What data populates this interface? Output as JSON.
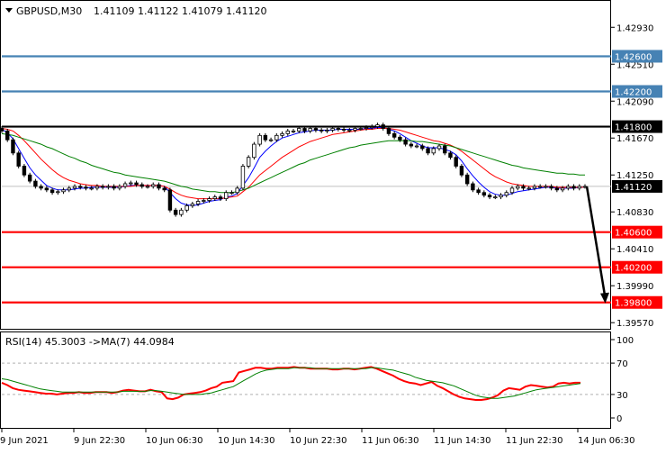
{
  "header": {
    "symbol_info": "GBPUSD,M30",
    "ohlc": "1.41109 1.41122 1.41079 1.41120"
  },
  "chart_data": [
    {
      "type": "candlestick",
      "symbol": "GBPUSD",
      "timeframe": "M30",
      "title": "GBPUSD,M30",
      "last_ohlc": {
        "open": 1.41109,
        "high": 1.41122,
        "low": 1.41079,
        "close": 1.4112
      },
      "y_ticks": [
        "1.42930",
        "1.42510",
        "1.42090",
        "1.41670",
        "1.41250",
        "1.40830",
        "1.40410",
        "1.39990",
        "1.39570"
      ],
      "ylim": [
        1.3949,
        1.4323
      ],
      "x_ticks": [
        "9 Jun 2021",
        "9 Jun 22:30",
        "10 Jun 06:30",
        "10 Jun 14:30",
        "10 Jun 22:30",
        "11 Jun 06:30",
        "11 Jun 14:30",
        "11 Jun 22:30",
        "14 Jun 06:30"
      ],
      "current_price": {
        "value": 1.4112,
        "label": "1.41120"
      },
      "levels": [
        {
          "value": 1.426,
          "label": "1.42600",
          "color": "#4682b4"
        },
        {
          "value": 1.422,
          "label": "1.42200",
          "color": "#4682b4"
        },
        {
          "value": 1.418,
          "label": "1.41800",
          "color": "#000000"
        },
        {
          "value": 1.406,
          "label": "1.40600",
          "color": "#ff0000"
        },
        {
          "value": 1.402,
          "label": "1.40200",
          "color": "#ff0000"
        },
        {
          "value": 1.398,
          "label": "1.39800",
          "color": "#ff0000"
        }
      ],
      "projection": {
        "from": 1.4112,
        "to": 1.398,
        "color": "#000000"
      },
      "close_series": [
        1.4175,
        1.4165,
        1.415,
        1.4135,
        1.4125,
        1.4118,
        1.4112,
        1.411,
        1.4108,
        1.4105,
        1.4106,
        1.4108,
        1.411,
        1.4112,
        1.4111,
        1.411,
        1.411,
        1.4112,
        1.4111,
        1.4112,
        1.411,
        1.4112,
        1.4115,
        1.4116,
        1.4114,
        1.4112,
        1.4112,
        1.4114,
        1.411,
        1.4108,
        1.4085,
        1.408,
        1.4085,
        1.409,
        1.4092,
        1.4095,
        1.4096,
        1.4098,
        1.41,
        1.4098,
        1.4105,
        1.4105,
        1.411,
        1.4135,
        1.4145,
        1.416,
        1.417,
        1.4165,
        1.4165,
        1.417,
        1.4172,
        1.4175,
        1.4175,
        1.4178,
        1.4175,
        1.4178,
        1.4176,
        1.4175,
        1.4176,
        1.4178,
        1.4177,
        1.4176,
        1.4176,
        1.4178,
        1.4178,
        1.4179,
        1.418,
        1.4182,
        1.4178,
        1.4172,
        1.4168,
        1.4165,
        1.416,
        1.4158,
        1.4158,
        1.4155,
        1.415,
        1.4155,
        1.4158,
        1.415,
        1.4145,
        1.4135,
        1.4125,
        1.4115,
        1.4108,
        1.4105,
        1.4102,
        1.41,
        1.41,
        1.4102,
        1.4105,
        1.411,
        1.4112,
        1.411,
        1.411,
        1.4112,
        1.4112,
        1.4112,
        1.411,
        1.4108,
        1.411,
        1.4112,
        1.411,
        1.4112,
        1.4112
      ],
      "moving_averages": [
        {
          "color": "#0000ff",
          "series": [
            1.4177,
            1.4173,
            1.4166,
            1.4155,
            1.4144,
            1.4133,
            1.4125,
            1.4119,
            1.4113,
            1.411,
            1.4108,
            1.4108,
            1.4108,
            1.4109,
            1.411,
            1.411,
            1.4111,
            1.4111,
            1.4111,
            1.4111,
            1.4111,
            1.4111,
            1.4112,
            1.4113,
            1.4113,
            1.4113,
            1.4113,
            1.4113,
            1.4113,
            1.4112,
            1.4105,
            1.4098,
            1.4093,
            1.4091,
            1.409,
            1.4091,
            1.4093,
            1.4095,
            1.4096,
            1.4097,
            1.41,
            1.4101,
            1.4104,
            1.4113,
            1.4122,
            1.4133,
            1.4145,
            1.4152,
            1.4158,
            1.4163,
            1.4167,
            1.4169,
            1.4171,
            1.4173,
            1.4174,
            1.4175,
            1.4176,
            1.4176,
            1.4176,
            1.4176,
            1.4177,
            1.4177,
            1.4177,
            1.4177,
            1.4177,
            1.4178,
            1.4178,
            1.4179,
            1.4179,
            1.4177,
            1.4175,
            1.4172,
            1.4168,
            1.4164,
            1.4161,
            1.4158,
            1.4156,
            1.4156,
            1.4156,
            1.4154,
            1.4152,
            1.4148,
            1.4141,
            1.4132,
            1.4124,
            1.4117,
            1.4111,
            1.4106,
            1.4103,
            1.4102,
            1.4102,
            1.4104,
            1.4106,
            1.4107,
            1.4108,
            1.4109,
            1.411,
            1.4111,
            1.4111,
            1.411,
            1.411,
            1.411,
            1.411,
            1.4111,
            1.4111
          ]
        },
        {
          "color": "#ff0000",
          "series": [
            1.4178,
            1.4177,
            1.4175,
            1.417,
            1.4164,
            1.4157,
            1.415,
            1.4143,
            1.4137,
            1.4131,
            1.4126,
            1.4122,
            1.4119,
            1.4117,
            1.4115,
            1.4114,
            1.4113,
            1.4113,
            1.4112,
            1.4112,
            1.4112,
            1.4112,
            1.4112,
            1.4112,
            1.4113,
            1.4113,
            1.4113,
            1.4113,
            1.4113,
            1.4112,
            1.4109,
            1.4105,
            1.4102,
            1.41,
            1.4099,
            1.4098,
            1.4098,
            1.4098,
            1.4098,
            1.4098,
            1.4099,
            1.41,
            1.4101,
            1.4106,
            1.4111,
            1.4118,
            1.4125,
            1.413,
            1.4135,
            1.414,
            1.4145,
            1.4149,
            1.4153,
            1.4157,
            1.416,
            1.4163,
            1.4165,
            1.4167,
            1.4169,
            1.4171,
            1.4172,
            1.4173,
            1.4174,
            1.4175,
            1.4176,
            1.4177,
            1.4177,
            1.4178,
            1.4178,
            1.4178,
            1.4177,
            1.4176,
            1.4174,
            1.4172,
            1.417,
            1.4168,
            1.4166,
            1.4164,
            1.4163,
            1.4161,
            1.4159,
            1.4156,
            1.4152,
            1.4147,
            1.4142,
            1.4137,
            1.4132,
            1.4127,
            1.4123,
            1.412,
            1.4117,
            1.4115,
            1.4114,
            1.4113,
            1.4112,
            1.4112,
            1.4112,
            1.4112,
            1.4112,
            1.4111,
            1.4111,
            1.4111,
            1.4111,
            1.4111,
            1.4111
          ]
        },
        {
          "color": "#008000",
          "series": [
            1.4172,
            1.4171,
            1.417,
            1.4168,
            1.4166,
            1.4164,
            1.4162,
            1.416,
            1.4157,
            1.4155,
            1.4152,
            1.4149,
            1.4146,
            1.4144,
            1.4141,
            1.4139,
            1.4136,
            1.4134,
            1.4132,
            1.413,
            1.4128,
            1.4127,
            1.4125,
            1.4124,
            1.4123,
            1.4122,
            1.4121,
            1.412,
            1.4119,
            1.4118,
            1.4116,
            1.4114,
            1.4112,
            1.4111,
            1.4109,
            1.4108,
            1.4107,
            1.4106,
            1.4106,
            1.4105,
            1.4105,
            1.4105,
            1.4106,
            1.4108,
            1.411,
            1.4113,
            1.4116,
            1.4119,
            1.4122,
            1.4125,
            1.4128,
            1.4131,
            1.4134,
            1.4137,
            1.4139,
            1.4142,
            1.4144,
            1.4146,
            1.4148,
            1.415,
            1.4152,
            1.4154,
            1.4156,
            1.4157,
            1.4159,
            1.416,
            1.4161,
            1.4162,
            1.4163,
            1.4164,
            1.4164,
            1.4164,
            1.4164,
            1.4164,
            1.4163,
            1.4163,
            1.4162,
            1.4161,
            1.416,
            1.4159,
            1.4158,
            1.4156,
            1.4154,
            1.4152,
            1.415,
            1.4148,
            1.4146,
            1.4144,
            1.4142,
            1.414,
            1.4138,
            1.4136,
            1.4135,
            1.4133,
            1.4132,
            1.4131,
            1.413,
            1.4129,
            1.4128,
            1.4127,
            1.4127,
            1.4126,
            1.4126,
            1.4125,
            1.4125
          ]
        }
      ]
    },
    {
      "type": "line",
      "title": "RSI(14) 45.3003 ->MA(7) 44.0984",
      "ylim": [
        0,
        100
      ],
      "y_ticks": [
        "100",
        "70",
        "30",
        "0"
      ],
      "levels": [
        70,
        30
      ],
      "series": [
        {
          "color": "#ff0000",
          "values": [
            45,
            42,
            38,
            36,
            35,
            34,
            33,
            32,
            31,
            31,
            30,
            31,
            32,
            32,
            33,
            32,
            32,
            33,
            33,
            33,
            32,
            33,
            35,
            36,
            35,
            34,
            34,
            36,
            34,
            33,
            25,
            24,
            26,
            30,
            31,
            32,
            33,
            35,
            38,
            40,
            45,
            46,
            47,
            58,
            60,
            62,
            64,
            64,
            63,
            63,
            64,
            64,
            64,
            65,
            64,
            64,
            63,
            63,
            63,
            63,
            62,
            62,
            63,
            63,
            62,
            63,
            64,
            65,
            63,
            60,
            57,
            54,
            50,
            47,
            45,
            44,
            42,
            44,
            46,
            41,
            38,
            34,
            30,
            27,
            25,
            24,
            23,
            23,
            24,
            26,
            29,
            35,
            38,
            37,
            36,
            40,
            42,
            41,
            40,
            39,
            40,
            44,
            45,
            44,
            45,
            45
          ]
        },
        {
          "color": "#008000",
          "values": [
            50,
            49,
            47,
            45,
            43,
            41,
            39,
            37,
            36,
            35,
            34,
            33,
            33,
            33,
            33,
            33,
            33,
            33,
            33,
            33,
            33,
            33,
            34,
            34,
            34,
            34,
            34,
            35,
            35,
            34,
            33,
            32,
            31,
            30,
            30,
            30,
            30,
            31,
            32,
            34,
            36,
            38,
            40,
            44,
            48,
            52,
            56,
            59,
            61,
            62,
            63,
            63,
            63,
            64,
            64,
            64,
            64,
            63,
            63,
            63,
            63,
            63,
            63,
            63,
            63,
            63,
            63,
            64,
            64,
            63,
            62,
            61,
            59,
            57,
            55,
            52,
            50,
            48,
            47,
            46,
            45,
            43,
            41,
            38,
            35,
            32,
            29,
            27,
            26,
            25,
            25,
            26,
            27,
            28,
            30,
            32,
            34,
            36,
            37,
            38,
            39,
            40,
            41,
            42,
            43,
            44
          ]
        }
      ]
    }
  ]
}
